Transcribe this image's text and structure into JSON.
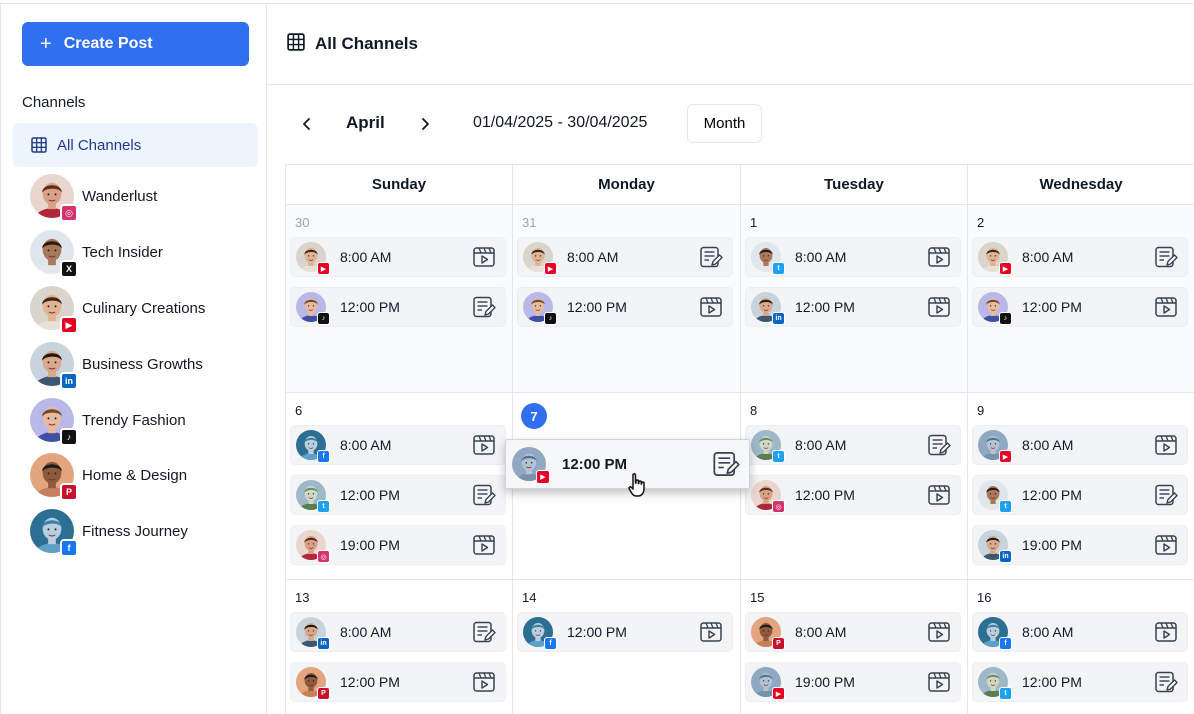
{
  "sidebar": {
    "create_label": "Create Post",
    "channels_heading": "Channels",
    "all_channels_label": "All Channels",
    "channels": [
      {
        "name": "Wanderlust",
        "network": "instagram",
        "skin": "#d9a185",
        "hair": "#5a2d1d",
        "shirt": "#b0273b"
      },
      {
        "name": "Tech Insider",
        "network": "x",
        "skin": "#a8795a",
        "hair": "#2a1c14",
        "shirt": "#e5e7eb"
      },
      {
        "name": "Culinary Creations",
        "network": "youtube",
        "skin": "#e0b493",
        "hair": "#3d2718",
        "shirt": "#e8e1d6"
      },
      {
        "name": "Business Growths",
        "network": "linkedin",
        "skin": "#d8a98a",
        "hair": "#241811",
        "shirt": "#3d5672"
      },
      {
        "name": "Trendy Fashion",
        "network": "tiktok",
        "skin": "#e7b99f",
        "hair": "#6b4a36",
        "shirt": "#3f4fa6"
      },
      {
        "name": "Home & Design",
        "network": "pinterest",
        "skin": "#8f5b3f",
        "hair": "#1b1b1b",
        "shirt": "#c77f5e"
      },
      {
        "name": "Fitness Journey",
        "network": "facebook",
        "skin": "#b9cfe0",
        "hair": "#3f7fa4",
        "shirt": "#5da0c8"
      }
    ]
  },
  "header": {
    "title": "All Channels"
  },
  "toolbar": {
    "month": "April",
    "range": "01/04/2025 - 30/04/2025",
    "view_label": "Month"
  },
  "calendar": {
    "days": [
      "Sunday",
      "Monday",
      "Tuesday",
      "Wednesday"
    ],
    "weeks": [
      [
        {
          "num": "30",
          "muted": true,
          "posts": [
            {
              "time": "8:00 AM",
              "network": "youtube",
              "type": "video",
              "avatar": 2
            },
            {
              "time": "12:00 PM",
              "network": "tiktok",
              "type": "text",
              "avatar": 4
            }
          ]
        },
        {
          "num": "31",
          "muted": true,
          "posts": [
            {
              "time": "8:00 AM",
              "network": "youtube",
              "type": "text",
              "avatar": 2
            },
            {
              "time": "12:00 PM",
              "network": "tiktok",
              "type": "video",
              "avatar": 4
            }
          ]
        },
        {
          "num": "1",
          "muted": true,
          "posts": [
            {
              "time": "8:00 AM",
              "network": "twitter",
              "type": "video",
              "avatar": 1
            },
            {
              "time": "12:00 PM",
              "network": "linkedin",
              "type": "video",
              "avatar": 3
            }
          ]
        },
        {
          "num": "2",
          "muted": true,
          "posts": [
            {
              "time": "8:00 AM",
              "network": "youtube",
              "type": "text",
              "avatar": 2
            },
            {
              "time": "12:00 PM",
              "network": "tiktok",
              "type": "video",
              "avatar": 4
            }
          ]
        }
      ],
      [
        {
          "num": "6",
          "muted": false,
          "posts": [
            {
              "time": "8:00 AM",
              "network": "facebook",
              "type": "video",
              "avatar": 6
            },
            {
              "time": "12:00 PM",
              "network": "twitter",
              "type": "text",
              "avatar": 7
            },
            {
              "time": "19:00 PM",
              "network": "instagram",
              "type": "video",
              "avatar": 0
            }
          ]
        },
        {
          "num": "7",
          "muted": false,
          "today": true,
          "posts": []
        },
        {
          "num": "8",
          "muted": false,
          "posts": [
            {
              "time": "8:00 AM",
              "network": "twitter",
              "type": "text",
              "avatar": 7
            },
            {
              "time": "12:00 PM",
              "network": "instagram",
              "type": "video",
              "avatar": 0
            }
          ]
        },
        {
          "num": "9",
          "muted": false,
          "posts": [
            {
              "time": "8:00 AM",
              "network": "youtube",
              "type": "video",
              "avatar": 8
            },
            {
              "time": "12:00 PM",
              "network": "twitter",
              "type": "text",
              "avatar": 1
            },
            {
              "time": "19:00 PM",
              "network": "linkedin",
              "type": "video",
              "avatar": 3
            }
          ]
        }
      ],
      [
        {
          "num": "13",
          "muted": false,
          "posts": [
            {
              "time": "8:00 AM",
              "network": "linkedin",
              "type": "text",
              "avatar": 3
            },
            {
              "time": "12:00 PM",
              "network": "pinterest",
              "type": "video",
              "avatar": 5
            }
          ]
        },
        {
          "num": "14",
          "muted": false,
          "posts": [
            {
              "time": "12:00 PM",
              "network": "facebook",
              "type": "video",
              "avatar": 6
            }
          ]
        },
        {
          "num": "15",
          "muted": false,
          "posts": [
            {
              "time": "8:00 AM",
              "network": "pinterest",
              "type": "video",
              "avatar": 5
            },
            {
              "time": "19:00 PM",
              "network": "youtube",
              "type": "video",
              "avatar": 8
            }
          ]
        },
        {
          "num": "16",
          "muted": false,
          "posts": [
            {
              "time": "8:00 AM",
              "network": "facebook",
              "type": "video",
              "avatar": 6
            },
            {
              "time": "12:00 PM",
              "network": "twitter",
              "type": "text",
              "avatar": 7
            }
          ]
        }
      ]
    ]
  },
  "dragging_post": {
    "time": "12:00 PM",
    "network": "youtube",
    "type": "text",
    "avatar": 8
  },
  "colors": {
    "accent": "#2f6ff0",
    "instagram": "#d6336c",
    "x": "#111111",
    "youtube": "#e60023",
    "linkedin": "#0a66c2",
    "tiktok": "#111111",
    "pinterest": "#c8102e",
    "facebook": "#1877f2",
    "twitter": "#1da1f2"
  },
  "avatars": [
    {
      "skin": "#d9a185",
      "hair": "#5a2d1d",
      "shirt": "#b0273b",
      "bg": "#e9d6cf"
    },
    {
      "skin": "#a8795a",
      "hair": "#2a1c14",
      "shirt": "#e5e7eb",
      "bg": "#dfe6ec"
    },
    {
      "skin": "#e0b493",
      "hair": "#3d2718",
      "shirt": "#e8e1d6",
      "bg": "#d9d4cc"
    },
    {
      "skin": "#d8a98a",
      "hair": "#241811",
      "shirt": "#3d5672",
      "bg": "#c9d3dc"
    },
    {
      "skin": "#e7b99f",
      "hair": "#6b4a36",
      "shirt": "#3f4fa6",
      "bg": "#b9b8e8"
    },
    {
      "skin": "#8f5b3f",
      "hair": "#1b1b1b",
      "shirt": "#c77f5e",
      "bg": "#e3a57d"
    },
    {
      "skin": "#b9cfe0",
      "hair": "#3f7fa4",
      "shirt": "#5da0c8",
      "bg": "#2c6f92"
    },
    {
      "skin": "#cfd8c4",
      "hair": "#6e8b6a",
      "shirt": "#5b7d52",
      "bg": "#9fb8c9"
    },
    {
      "skin": "#b3c3d4",
      "hair": "#52718d",
      "shirt": "#7892ab",
      "bg": "#8fa9c3"
    }
  ]
}
